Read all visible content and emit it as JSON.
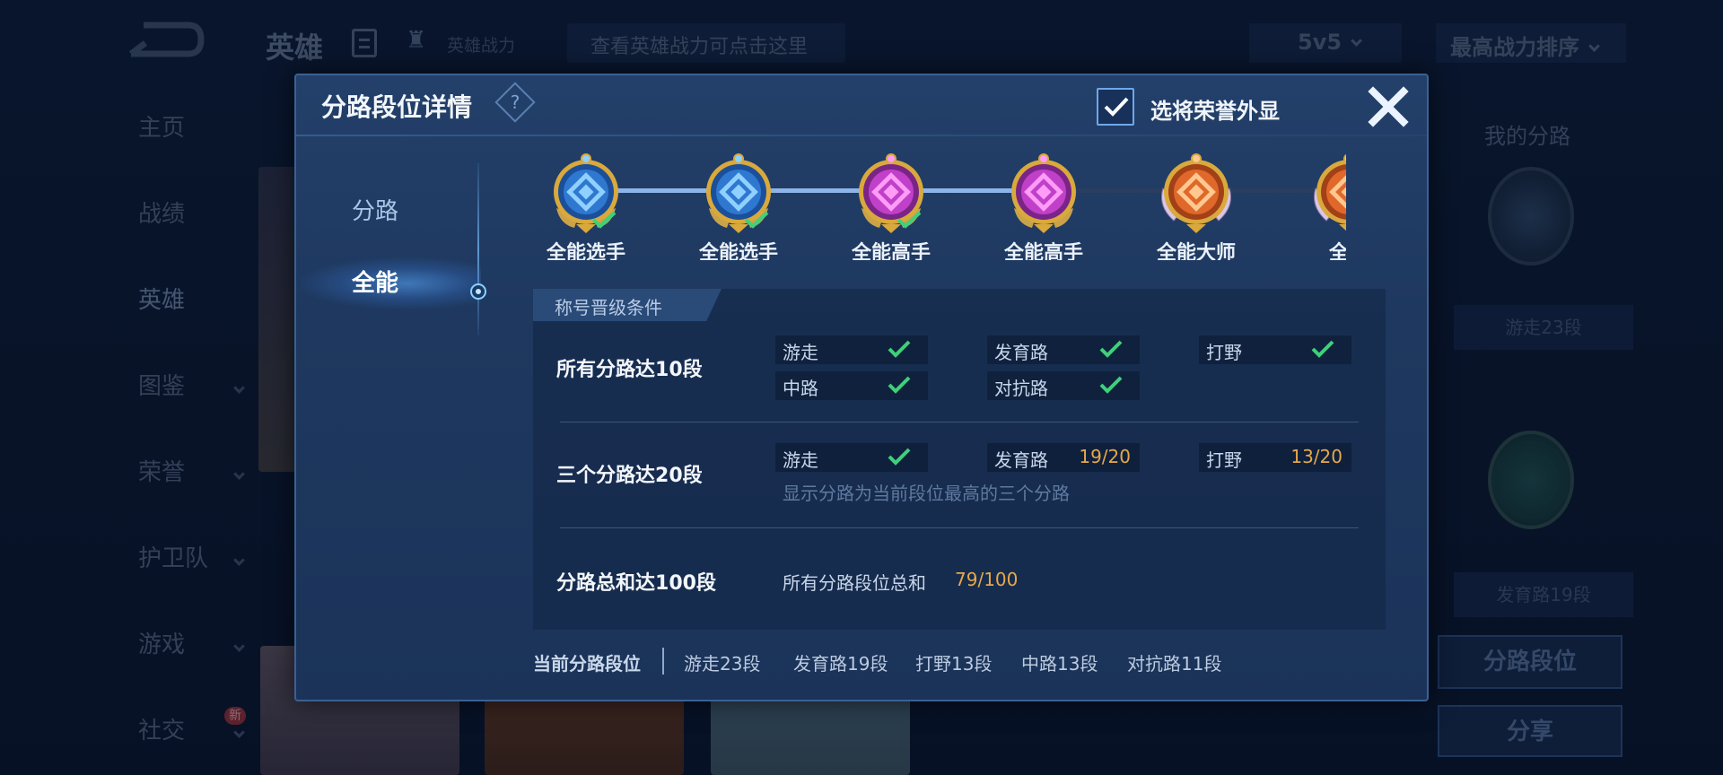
{
  "background": {
    "top_title": "英雄",
    "top_power_label": "英雄战力",
    "search_placeholder": "查看英雄战力可点击这里",
    "mode_select": "5v5",
    "sort_select": "最高战力排序",
    "nav": [
      {
        "label": "主页"
      },
      {
        "label": "战绩"
      },
      {
        "label": "英雄"
      },
      {
        "label": "图鉴"
      },
      {
        "label": "荣誉"
      },
      {
        "label": "护卫队"
      },
      {
        "label": "游戏"
      },
      {
        "label": "社交",
        "badge": "新"
      }
    ],
    "right_title": "我的分路",
    "right_label_1": "游走23段",
    "right_label_2": "发育路19段",
    "right_btn_rank": "分路段位",
    "right_btn_share": "分享"
  },
  "modal": {
    "title": "分路段位详情",
    "help": "?",
    "honor_toggle": {
      "label": "选将荣誉外显",
      "checked": true
    },
    "tabs": [
      {
        "label": "分路",
        "active": false
      },
      {
        "label": "全能",
        "active": true
      }
    ],
    "ranks": [
      {
        "label": "全能选手",
        "tier": "blue",
        "achieved": true
      },
      {
        "label": "全能选手",
        "tier": "blue",
        "achieved": true
      },
      {
        "label": "全能高手",
        "tier": "purple",
        "achieved": true
      },
      {
        "label": "全能高手",
        "tier": "purple",
        "achieved": false
      },
      {
        "label": "全能大师",
        "tier": "orange",
        "achieved": false
      },
      {
        "label": "全能",
        "tier": "orange",
        "achieved": false
      }
    ],
    "conditions_header": "称号晋级条件",
    "conditions": {
      "row1": {
        "title_prefix": "所有分路达",
        "title_num": "10",
        "title_suffix": "段",
        "chips": [
          {
            "label": "游走",
            "done": true
          },
          {
            "label": "发育路",
            "done": true
          },
          {
            "label": "打野",
            "done": true
          },
          {
            "label": "中路",
            "done": true
          },
          {
            "label": "对抗路",
            "done": true
          }
        ]
      },
      "row2": {
        "title_prefix": "三个分路达",
        "title_num": "20",
        "title_suffix": "段",
        "chips": [
          {
            "label": "游走",
            "done": true
          },
          {
            "label": "发育路",
            "progress": "19/20"
          },
          {
            "label": "打野",
            "progress": "13/20"
          }
        ],
        "note": "显示分路为当前段位最高的三个分路"
      },
      "row3": {
        "title_prefix": "分路总和达",
        "title_num": "100",
        "title_suffix": "段",
        "text": "所有分路段位总和",
        "value": "79/100"
      }
    },
    "footer": {
      "label": "当前分路段位",
      "items": [
        "游走23段",
        "发育路19段",
        "打野13段",
        "中路13段",
        "对抗路11段"
      ]
    }
  },
  "colors": {
    "accent_blue": "#6fa8e8",
    "check_green": "#3fd07a",
    "progress_orange": "#e6a84a",
    "modal_bg": "#1f3a62"
  }
}
